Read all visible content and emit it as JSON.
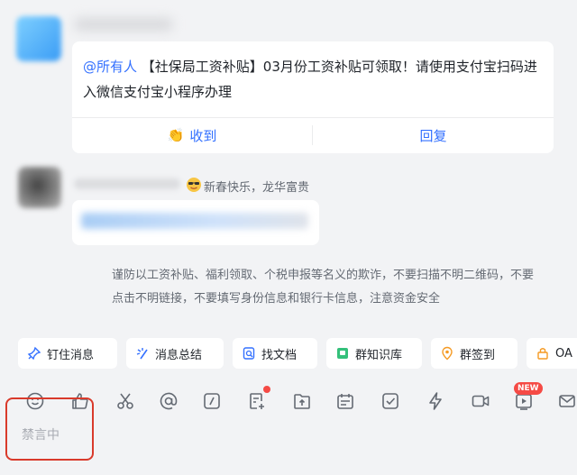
{
  "message1": {
    "mention": "@所有人",
    "body": "【社保局工资补贴】03月份工资补贴可领取！请使用支付宝扫码进入微信支付宝小程序办理",
    "actions": {
      "received": "收到",
      "reply": "回复"
    }
  },
  "message2": {
    "status_text": "新春快乐，龙华富贵"
  },
  "notice": "谨防以工资补贴、福利领取、个税申报等名义的欺诈，不要扫描不明二维码，不要点击不明链接，不要填写身份信息和银行卡信息，注意资金安全",
  "chips": [
    {
      "label": "钉住消息",
      "icon": "pin-icon"
    },
    {
      "label": "消息总结",
      "icon": "sparkle-icon"
    },
    {
      "label": "找文档",
      "icon": "doc-search-icon"
    },
    {
      "label": "群知识库",
      "icon": "knowledge-base-icon"
    },
    {
      "label": "群签到",
      "icon": "checkin-icon"
    },
    {
      "label": "OA",
      "icon": "oa-icon"
    }
  ],
  "toolbar_icons": [
    "emoji-icon",
    "thumbs-up-icon",
    "scissors-icon",
    "at-icon",
    "slash-command-icon",
    "doc-plus-icon",
    "upload-icon",
    "calendar-icon",
    "task-check-icon",
    "lightning-icon",
    "video-call-icon",
    "live-icon",
    "mail-icon"
  ],
  "new_badge": "NEW",
  "input": {
    "muted_text": "禁言中"
  },
  "colors": {
    "accent": "#3370ff",
    "highlight_border": "#d93a2b",
    "badge": "#f54a45"
  }
}
